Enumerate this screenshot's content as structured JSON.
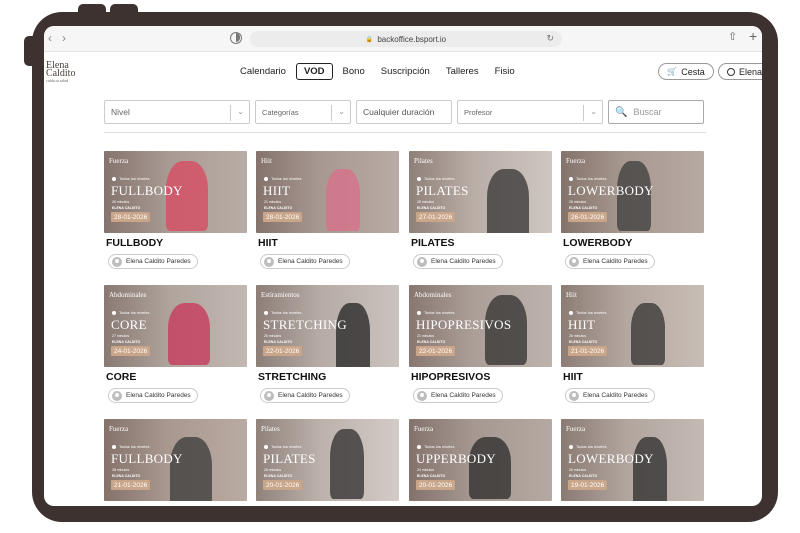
{
  "browser": {
    "url": "backoffice.bsport.io",
    "back_glyph": "‹",
    "forward_glyph": "›",
    "lock_glyph": "🔒",
    "reload_glyph": "↻",
    "share_glyph": "⇧",
    "newtab_glyph": "+"
  },
  "site": {
    "logo_line1": "Elena",
    "logo_line2": "Caldito",
    "logo_tag": "cuida tu salud",
    "nav": [
      {
        "label": "Calendario"
      },
      {
        "label": "VOD",
        "active": true
      },
      {
        "label": "Bono"
      },
      {
        "label": "Suscripción"
      },
      {
        "label": "Talleres"
      },
      {
        "label": "Fisio"
      }
    ],
    "cart_label": "Cesta",
    "user_label": "Elena"
  },
  "filters": {
    "level": "Nivel",
    "categories": "Categorías",
    "duration": "Cualquier duración",
    "teacher": "Profesor",
    "search_placeholder": "Buscar",
    "chevron_glyph": "⌄"
  },
  "cards": [
    {
      "category": "Fuerza",
      "level": "Todos los niveles",
      "big": "FULLBODY",
      "duration": "26 minutos",
      "author": "ELENA CALDITO",
      "date": "28-01-2026",
      "title": "FULLBODY",
      "teacher": "Elena Caldito Paredes",
      "bg": "#b9aca6",
      "accent": "#d9475f"
    },
    {
      "category": "Hiit",
      "level": "Todos los niveles",
      "big": "HIIT",
      "duration": "21 minutos",
      "author": "ELENA CALDITO",
      "date": "28-01-2026",
      "title": "HIIT",
      "teacher": "Elena Caldito Paredes",
      "bg": "#b8aaa4",
      "accent": "#d96d8a"
    },
    {
      "category": "Pilates",
      "level": "Todos los niveles",
      "big": "PILATES",
      "duration": "28 minutos",
      "author": "ELENA CALDITO",
      "date": "27-01-2026",
      "title": "PILATES",
      "teacher": "Elena Caldito Paredes",
      "bg": "#cfc6c0",
      "accent": "#333333"
    },
    {
      "category": "Fuerza",
      "level": "Todos los niveles",
      "big": "LOWERBODY",
      "duration": "26 minutos",
      "author": "ELENA CALDITO",
      "date": "26-01-2026",
      "title": "LOWERBODY",
      "teacher": "Elena Caldito Paredes",
      "bg": "#b7aaa2",
      "accent": "#3c3c3c"
    },
    {
      "category": "Abdominales",
      "level": "Todos los niveles",
      "big": "CORE",
      "duration": "27 minutos",
      "author": "ELENA CALDITO",
      "date": "24-01-2026",
      "title": "CORE",
      "teacher": "Elena Caldito Paredes",
      "bg": "#c2b8b2",
      "accent": "#c9345a"
    },
    {
      "category": "Estiramientos",
      "level": "Todos los niveles",
      "big": "STRETCHING",
      "duration": "26 minutos",
      "author": "ELENA CALDITO",
      "date": "22-01-2026",
      "title": "STRETCHING",
      "teacher": "Elena Caldito Paredes",
      "bg": "#cbc3be",
      "accent": "#222222"
    },
    {
      "category": "Abdominales",
      "level": "Todos los niveles",
      "big": "HIPOPRESIVOS",
      "duration": "21 minutos",
      "author": "ELENA CALDITO",
      "date": "22-01-2026",
      "title": "HIPOPRESIVOS",
      "teacher": "Elena Caldito Paredes",
      "bg": "#bdb2ac",
      "accent": "#2f2f2f"
    },
    {
      "category": "Hiit",
      "level": "Todos los niveles",
      "big": "HIIT",
      "duration": "26 minutos",
      "author": "ELENA CALDITO",
      "date": "21-01-2026",
      "title": "HIIT",
      "teacher": "Elena Caldito Paredes",
      "bg": "#c8bdb6",
      "accent": "#333333"
    },
    {
      "category": "Fuerza",
      "level": "Todos los niveles",
      "big": "FULLBODY",
      "duration": "28 minutos",
      "author": "ELENA CALDITO",
      "date": "21-01-2026",
      "title": "",
      "teacher": "",
      "bg": "#b9aaa2",
      "accent": "#3a3a3a"
    },
    {
      "category": "Pilates",
      "level": "Todos los niveles",
      "big": "PILATES",
      "duration": "26 minutos",
      "author": "ELENA CALDITO",
      "date": "20-01-2026",
      "title": "",
      "teacher": "",
      "bg": "#d3cbc6",
      "accent": "#2e2e2e"
    },
    {
      "category": "Fuerza",
      "level": "Todos los niveles",
      "big": "UPPERBODY",
      "duration": "24 minutos",
      "author": "ELENA CALDITO",
      "date": "20-01-2026",
      "title": "",
      "teacher": "",
      "bg": "#b5a9a3",
      "accent": "#2a2a2a"
    },
    {
      "category": "Fuerza",
      "level": "Todos los niveles",
      "big": "LOWERBODY",
      "duration": "26 minutos",
      "author": "ELENA CALDITO",
      "date": "19-01-2026",
      "title": "",
      "teacher": "",
      "bg": "#c4bab4",
      "accent": "#2b2b2b"
    }
  ]
}
